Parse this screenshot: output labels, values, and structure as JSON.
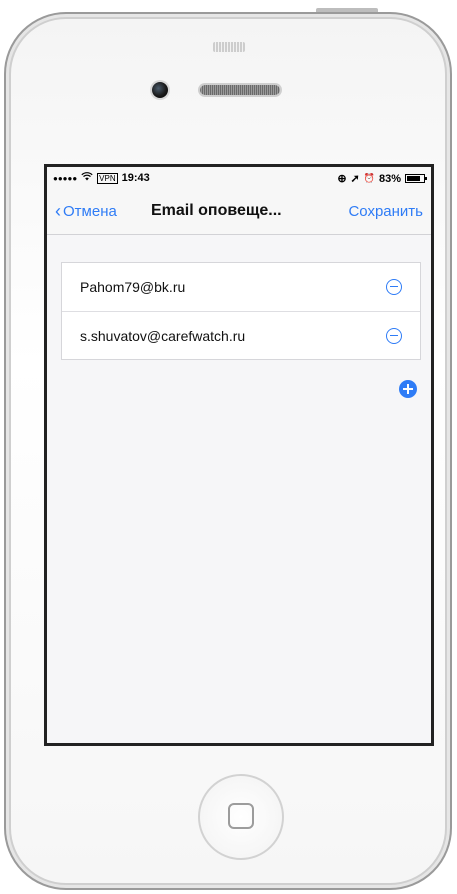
{
  "status_bar": {
    "signal": "●●●●●",
    "wifi_icon": "wifi-icon",
    "vpn": "VPN",
    "time": "19:43",
    "right_icons": [
      "rotation-lock-icon",
      "location-icon",
      "alarm-icon"
    ],
    "rotation_glyph": "⊕",
    "location_glyph": "➚",
    "alarm_glyph": "⏰",
    "battery_percent": "83%",
    "battery_level": 0.83
  },
  "nav": {
    "back_label": "Отмена",
    "back_chevron": "‹",
    "title": "Email оповеще...",
    "save_label": "Сохранить"
  },
  "emails": [
    {
      "address": "Pahom79@bk.ru"
    },
    {
      "address": "s.shuvatov@carefwatch.ru"
    }
  ],
  "colors": {
    "accent": "#2f7cf6",
    "background": "#f6f6f8"
  }
}
